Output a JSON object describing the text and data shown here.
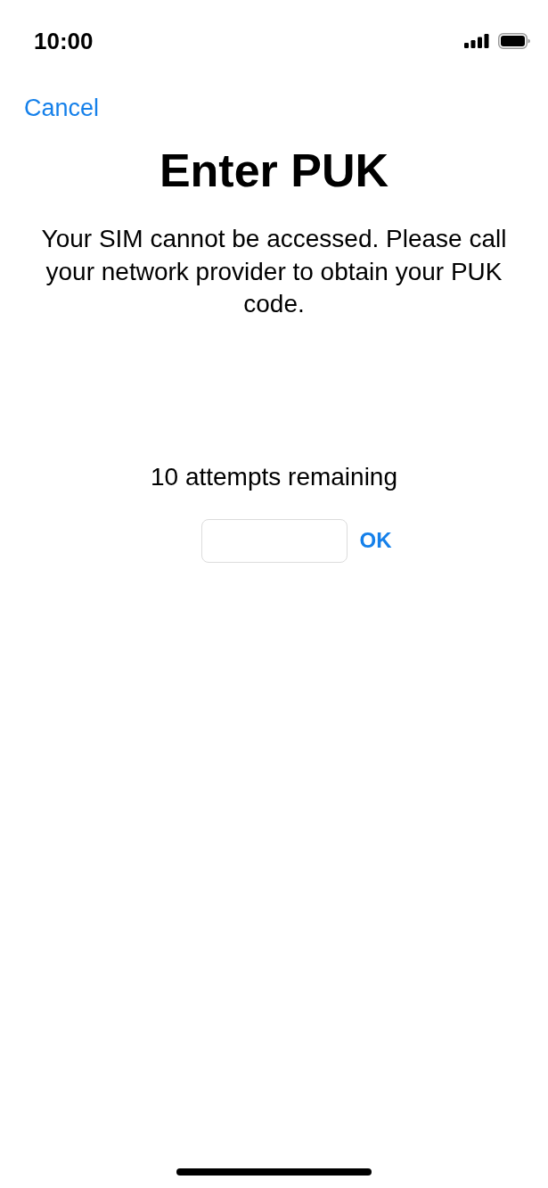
{
  "status_bar": {
    "time": "10:00"
  },
  "navigation": {
    "cancel": "Cancel"
  },
  "title": "Enter PUK",
  "message": "Your SIM cannot be accessed. Please call your network provider to obtain your PUK code.",
  "attempts": "10 attempts remaining",
  "entry": {
    "button": "OK"
  }
}
